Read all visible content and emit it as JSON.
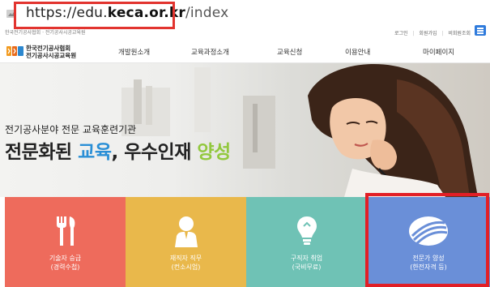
{
  "browser": {
    "url_scheme": "https://edu.",
    "url_domain": "keca.or.kr",
    "url_path": "/index"
  },
  "util": {
    "breadcrumb": "한국전기공사협회 · 전기공사시공교육원",
    "login": "로그인",
    "join": "회원가입",
    "guest": "비회원조회"
  },
  "nav": {
    "logo_line1": "한국전기공사협회",
    "logo_line2": "전기공사시공교육원",
    "items": [
      "개발원소개",
      "교육과정소개",
      "교육신청",
      "이용안내",
      "마이페이지"
    ]
  },
  "hero": {
    "subtitle": "전기공사분야 전문 교육훈련기관",
    "title_part1": "전문화된 ",
    "title_blue": "교육",
    "title_part2": ", 우수인재 ",
    "title_green": "양성"
  },
  "tiles": [
    {
      "line1": "기술자 승급",
      "line2": "(경력수첩)",
      "color": "#ee6b5c",
      "icon": "wrench-fork-icon"
    },
    {
      "line1": "재직자 직무",
      "line2": "(컨소시엄)",
      "color": "#e9b84b",
      "icon": "worker-icon"
    },
    {
      "line1": "구직자 취업",
      "line2": "(국비무료)",
      "color": "#6fc2b5",
      "icon": "lightbulb-icon"
    },
    {
      "line1": "전문가 양성",
      "line2": "(한전자격 등)",
      "color": "#6a8fd8",
      "icon": "globe-logo-icon"
    }
  ],
  "colors": {
    "highlight": "#e2342f",
    "accent_blue": "#2a8fd6",
    "accent_green": "#92c83e",
    "menu_button": "#2f7bdc"
  }
}
